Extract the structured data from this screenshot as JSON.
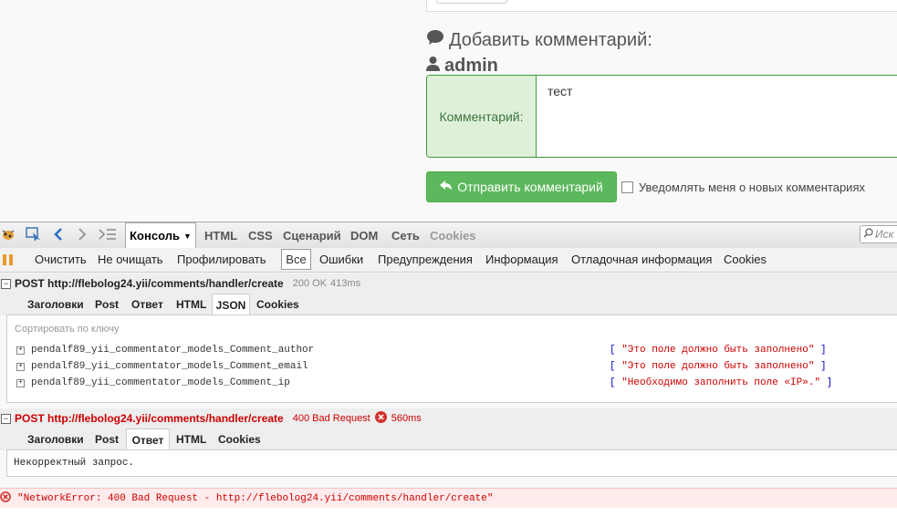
{
  "page": {
    "add_comment_title": "Добавить комментарий:",
    "user_name": "admin",
    "comment_label": "Комментарий:",
    "comment_value": "тест",
    "submit_label": "Отправить комментарий",
    "notify_label": "Уведомлять меня о новых комментариях"
  },
  "firebug": {
    "main_tabs": [
      "Консоль",
      "HTML",
      "CSS",
      "Сценарий",
      "DOM",
      "Сеть",
      "Cookies"
    ],
    "search_placeholder": "Иск",
    "filter_items": [
      "Очистить",
      "Не очищать",
      "Профилировать",
      "Все",
      "Ошибки",
      "Предупреждения",
      "Информация",
      "Отладочная информация",
      "Cookies"
    ],
    "request1": {
      "method_url": "POST http://flebolog24.yii/comments/handler/create",
      "status": "200 OK",
      "time": "413ms",
      "tabs": [
        "Заголовки",
        "Post",
        "Ответ",
        "HTML",
        "JSON",
        "Cookies"
      ],
      "sort_label": "Сортировать по ключу",
      "json_rows": [
        {
          "key": "pendalf89_yii_commentator_models_Comment_author",
          "value": "\"Это поле должно быть заполнено\""
        },
        {
          "key": "pendalf89_yii_commentator_models_Comment_email",
          "value": "\"Это поле должно быть заполнено\""
        },
        {
          "key": "pendalf89_yii_commentator_models_Comment_ip",
          "value": "\"Необходимо заполнить поле «IP».\""
        }
      ]
    },
    "request2": {
      "method_url": "POST http://flebolog24.yii/comments/handler/create",
      "status": "400 Bad Request",
      "time": "560ms",
      "tabs": [
        "Заголовки",
        "Post",
        "Ответ",
        "HTML",
        "Cookies"
      ],
      "response_text": "Некорректный запрос."
    },
    "error_message": "\"NetworkError: 400 Bad Request - http://flebolog24.yii/comments/handler/create\""
  },
  "colors": {
    "accent_green": "#5cb85c",
    "error_red": "#cc0000",
    "label_green": "#dff0d8"
  }
}
